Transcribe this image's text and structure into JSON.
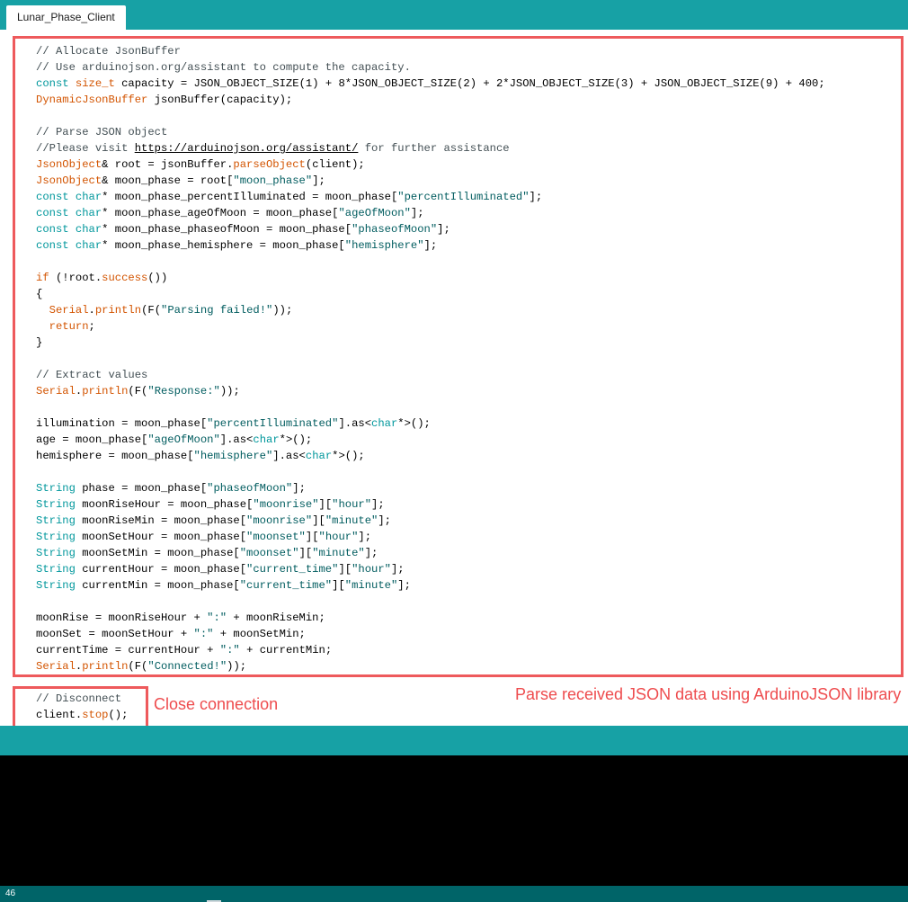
{
  "tab": {
    "label": "Lunar_Phase_Client"
  },
  "code_lines": [
    [
      [
        "c",
        "// Allocate JsonBuffer"
      ]
    ],
    [
      [
        "c",
        "// Use arduinojson.org/assistant to compute the capacity."
      ]
    ],
    [
      [
        "k",
        "const "
      ],
      [
        "o",
        "size_t"
      ],
      [
        "p",
        " capacity = JSON_OBJECT_SIZE(1) + 8*JSON_OBJECT_SIZE(2) + 2*JSON_OBJECT_SIZE(3) + JSON_OBJECT_SIZE(9) + 400;"
      ]
    ],
    [
      [
        "o",
        "DynamicJsonBuffer"
      ],
      [
        "p",
        " jsonBuffer(capacity);"
      ]
    ],
    [],
    [
      [
        "c",
        "// Parse JSON object"
      ]
    ],
    [
      [
        "c",
        "//Please visit "
      ],
      [
        "u",
        "https://arduinojson.org/assistant/"
      ],
      [
        "c",
        " for further assistance"
      ]
    ],
    [
      [
        "o",
        "JsonObject"
      ],
      [
        "p",
        "& root = jsonBuffer."
      ],
      [
        "o",
        "parseObject"
      ],
      [
        "p",
        "(client);"
      ]
    ],
    [
      [
        "o",
        "JsonObject"
      ],
      [
        "p",
        "& moon_phase = root["
      ],
      [
        "s",
        "\"moon_phase\""
      ],
      [
        "p",
        "];"
      ]
    ],
    [
      [
        "k",
        "const char"
      ],
      [
        "p",
        "* moon_phase_percentIlluminated = moon_phase["
      ],
      [
        "s",
        "\"percentIlluminated\""
      ],
      [
        "p",
        "];"
      ]
    ],
    [
      [
        "k",
        "const char"
      ],
      [
        "p",
        "* moon_phase_ageOfMoon = moon_phase["
      ],
      [
        "s",
        "\"ageOfMoon\""
      ],
      [
        "p",
        "];"
      ]
    ],
    [
      [
        "k",
        "const char"
      ],
      [
        "p",
        "* moon_phase_phaseofMoon = moon_phase["
      ],
      [
        "s",
        "\"phaseofMoon\""
      ],
      [
        "p",
        "];"
      ]
    ],
    [
      [
        "k",
        "const char"
      ],
      [
        "p",
        "* moon_phase_hemisphere = moon_phase["
      ],
      [
        "s",
        "\"hemisphere\""
      ],
      [
        "p",
        "];"
      ]
    ],
    [],
    [
      [
        "o",
        "if"
      ],
      [
        "p",
        " (!root."
      ],
      [
        "o",
        "success"
      ],
      [
        "p",
        "())"
      ]
    ],
    [
      [
        "p",
        "{"
      ]
    ],
    [
      [
        "p",
        "  "
      ],
      [
        "o",
        "Serial"
      ],
      [
        "p",
        "."
      ],
      [
        "o",
        "println"
      ],
      [
        "p",
        "(F("
      ],
      [
        "s",
        "\"Parsing failed!\""
      ],
      [
        "p",
        "));"
      ]
    ],
    [
      [
        "p",
        "  "
      ],
      [
        "o",
        "return"
      ],
      [
        "p",
        ";"
      ]
    ],
    [
      [
        "p",
        "}"
      ]
    ],
    [],
    [
      [
        "c",
        "// Extract values"
      ]
    ],
    [
      [
        "o",
        "Serial"
      ],
      [
        "p",
        "."
      ],
      [
        "o",
        "println"
      ],
      [
        "p",
        "(F("
      ],
      [
        "s",
        "\"Response:\""
      ],
      [
        "p",
        "));"
      ]
    ],
    [],
    [
      [
        "p",
        "illumination = moon_phase["
      ],
      [
        "s",
        "\"percentIlluminated\""
      ],
      [
        "p",
        "].as<"
      ],
      [
        "k",
        "char"
      ],
      [
        "p",
        "*>();"
      ]
    ],
    [
      [
        "p",
        "age = moon_phase["
      ],
      [
        "s",
        "\"ageOfMoon\""
      ],
      [
        "p",
        "].as<"
      ],
      [
        "k",
        "char"
      ],
      [
        "p",
        "*>();"
      ]
    ],
    [
      [
        "p",
        "hemisphere = moon_phase["
      ],
      [
        "s",
        "\"hemisphere\""
      ],
      [
        "p",
        "].as<"
      ],
      [
        "k",
        "char"
      ],
      [
        "p",
        "*>();"
      ]
    ],
    [],
    [
      [
        "k",
        "String"
      ],
      [
        "p",
        " phase = moon_phase["
      ],
      [
        "s",
        "\"phaseofMoon\""
      ],
      [
        "p",
        "];"
      ]
    ],
    [
      [
        "k",
        "String"
      ],
      [
        "p",
        " moonRiseHour = moon_phase["
      ],
      [
        "s",
        "\"moonrise\""
      ],
      [
        "p",
        "]["
      ],
      [
        "s",
        "\"hour\""
      ],
      [
        "p",
        "];"
      ]
    ],
    [
      [
        "k",
        "String"
      ],
      [
        "p",
        " moonRiseMin = moon_phase["
      ],
      [
        "s",
        "\"moonrise\""
      ],
      [
        "p",
        "]["
      ],
      [
        "s",
        "\"minute\""
      ],
      [
        "p",
        "];"
      ]
    ],
    [
      [
        "k",
        "String"
      ],
      [
        "p",
        " moonSetHour = moon_phase["
      ],
      [
        "s",
        "\"moonset\""
      ],
      [
        "p",
        "]["
      ],
      [
        "s",
        "\"hour\""
      ],
      [
        "p",
        "];"
      ]
    ],
    [
      [
        "k",
        "String"
      ],
      [
        "p",
        " moonSetMin = moon_phase["
      ],
      [
        "s",
        "\"moonset\""
      ],
      [
        "p",
        "]["
      ],
      [
        "s",
        "\"minute\""
      ],
      [
        "p",
        "];"
      ]
    ],
    [
      [
        "k",
        "String"
      ],
      [
        "p",
        " currentHour = moon_phase["
      ],
      [
        "s",
        "\"current_time\""
      ],
      [
        "p",
        "]["
      ],
      [
        "s",
        "\"hour\""
      ],
      [
        "p",
        "];"
      ]
    ],
    [
      [
        "k",
        "String"
      ],
      [
        "p",
        " currentMin = moon_phase["
      ],
      [
        "s",
        "\"current_time\""
      ],
      [
        "p",
        "]["
      ],
      [
        "s",
        "\"minute\""
      ],
      [
        "p",
        "];"
      ]
    ],
    [],
    [
      [
        "p",
        "moonRise = moonRiseHour + "
      ],
      [
        "s",
        "\":\""
      ],
      [
        "p",
        " + moonRiseMin;"
      ]
    ],
    [
      [
        "p",
        "moonSet = moonSetHour + "
      ],
      [
        "s",
        "\":\""
      ],
      [
        "p",
        " + moonSetMin;"
      ]
    ],
    [
      [
        "p",
        "currentTime = currentHour + "
      ],
      [
        "s",
        "\":\""
      ],
      [
        "p",
        " + currentMin;"
      ]
    ],
    [
      [
        "o",
        "Serial"
      ],
      [
        "p",
        "."
      ],
      [
        "o",
        "println"
      ],
      [
        "p",
        "(F("
      ],
      [
        "s",
        "\"Connected!\""
      ],
      [
        "p",
        "));"
      ]
    ],
    [],
    [
      [
        "c",
        "// Disconnect"
      ]
    ],
    [
      [
        "p",
        "client."
      ],
      [
        "o",
        "stop"
      ],
      [
        "p",
        "();"
      ]
    ]
  ],
  "annotations": {
    "parse_label": "Parse received JSON data using ArduinoJSON library",
    "close_label": "Close connection",
    "highlight_color": "#ee5a5c"
  },
  "status": {
    "line_number": "46"
  },
  "colors": {
    "toolbar": "#17a1a5",
    "status_bar": "#006468",
    "console": "#000000",
    "keyword": "#00979c",
    "function": "#d35400",
    "string": "#005c5f",
    "comment": "#434f54"
  }
}
